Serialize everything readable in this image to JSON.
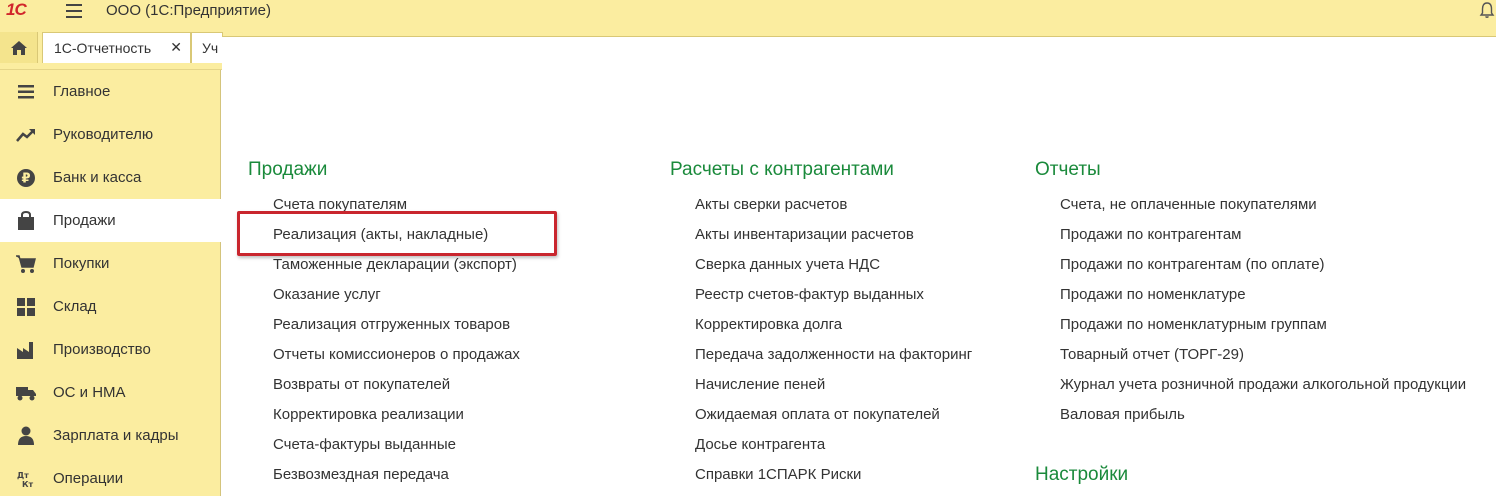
{
  "titlebar": {
    "logo_text": "1С",
    "app_title": "ООО  (1С:Предприятие)"
  },
  "tabs": [
    {
      "label": "1С-Отчетность"
    },
    {
      "label": "Уч"
    }
  ],
  "sidebar": {
    "items": [
      {
        "label": "Главное",
        "icon": "menu-lines-icon"
      },
      {
        "label": "Руководителю",
        "icon": "trend-arrow-icon"
      },
      {
        "label": "Банк и касса",
        "icon": "ruble-coin-icon"
      },
      {
        "label": "Продажи",
        "icon": "shopping-bag-icon"
      },
      {
        "label": "Покупки",
        "icon": "cart-icon"
      },
      {
        "label": "Склад",
        "icon": "boxes-icon"
      },
      {
        "label": "Производство",
        "icon": "factory-icon"
      },
      {
        "label": "ОС и НМА",
        "icon": "truck-icon"
      },
      {
        "label": "Зарплата и кадры",
        "icon": "person-icon"
      },
      {
        "label": "Операции",
        "icon": "debit-credit-icon"
      }
    ],
    "active_index": 3
  },
  "main": {
    "columns": [
      {
        "title": "Продажи",
        "links": [
          "Счета покупателям",
          "Реализация (акты, накладные)",
          "Таможенные декларации (экспорт)",
          "Оказание услуг",
          "Реализация отгруженных товаров",
          "Отчеты комиссионеров о продажах",
          "Возвраты от покупателей",
          "Корректировка реализации",
          "Счета-фактуры выданные",
          "Безвозмездная передача"
        ]
      },
      {
        "title": "Расчеты с контрагентами",
        "links": [
          "Акты сверки расчетов",
          "Акты инвентаризации расчетов",
          "Сверка данных учета НДС",
          "Реестр счетов-фактур выданных",
          "Корректировка долга",
          "Передача задолженности на факторинг",
          "Начисление пеней",
          "Ожидаемая оплата от покупателей",
          "Досье контрагента",
          "Справки 1СПАРК Риски"
        ]
      },
      {
        "title": "Отчеты",
        "links": [
          "Счета, не оплаченные покупателями",
          "Продажи по контрагентам",
          "Продажи по контрагентам (по оплате)",
          "Продажи по номенклатуре",
          "Продажи по номенклатурным группам",
          "Товарный отчет (ТОРГ-29)",
          "Журнал учета розничной продажи алкогольной продукции",
          "Валовая прибыль"
        ]
      }
    ],
    "settings_title": "Настройки"
  },
  "colors": {
    "accent_yellow": "#fbeda0",
    "section_green": "#1a8a3b",
    "highlight_red": "#c9262e",
    "logo_red": "#d1262b"
  }
}
